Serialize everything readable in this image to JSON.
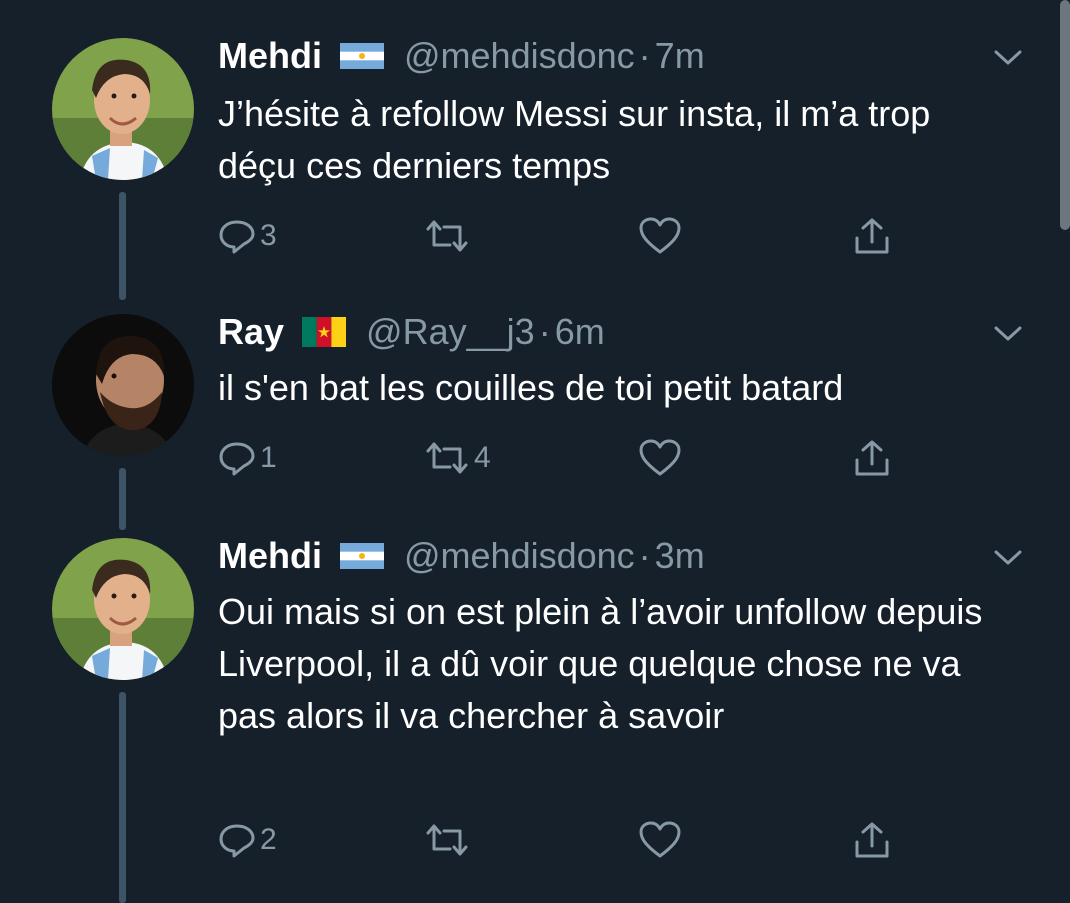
{
  "tweets": [
    {
      "name": "Mehdi",
      "flag": "argentina-flag",
      "handle": "@mehdisdonc",
      "separator": "·",
      "time": "7m",
      "text": "J’hésite à refollow Messi sur insta, il m’a trop déçu ces derniers temps",
      "replies": "3",
      "retweets": "",
      "likes": ""
    },
    {
      "name": "Ray",
      "flag": "cameroon-flag",
      "handle": "@Ray__j3",
      "separator": "·",
      "time": "6m",
      "text": "il s'en bat les couilles de toi petit batard",
      "replies": "1",
      "retweets": "4",
      "likes": ""
    },
    {
      "name": "Mehdi",
      "flag": "argentina-flag",
      "handle": "@mehdisdonc",
      "separator": "·",
      "time": "3m",
      "text": "Oui mais si on est plein à l’avoir unfollow depuis Liverpool, il a dû voir que quelque chose ne va pas alors il va chercher à savoir",
      "replies": "2",
      "retweets": "",
      "likes": ""
    }
  ],
  "icons": {
    "reply": "reply-icon",
    "retweet": "retweet-icon",
    "like": "heart-icon",
    "share": "share-icon",
    "caret": "chevron-down-icon"
  },
  "colors": {
    "background": "#15202b",
    "secondary_text": "#8899a6",
    "thread_line": "#3d5466"
  }
}
